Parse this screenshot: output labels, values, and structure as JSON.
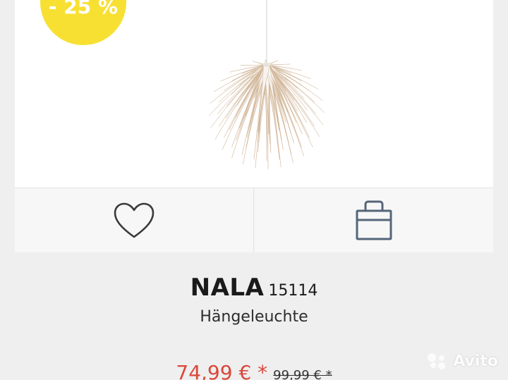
{
  "product": {
    "discount_badge": "- 25 %",
    "name": "NALA",
    "number": "15114",
    "subtitle": "Hängeleuchte",
    "price": "74,99 € *",
    "old_price": "99,99 € *"
  },
  "actions": {
    "wishlist_icon": "heart-icon",
    "cart_icon": "shopping-bag-icon"
  },
  "watermark": {
    "text": "Avito"
  },
  "colors": {
    "badge": "#f8e033",
    "price": "#d9483b",
    "icon": "#55657a"
  }
}
